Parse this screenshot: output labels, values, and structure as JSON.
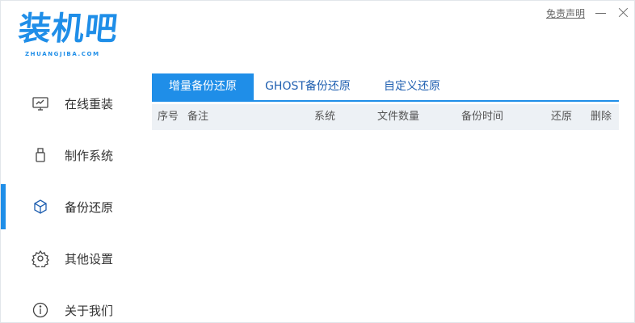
{
  "app": {
    "logo_text": "装机吧",
    "logo_subtext": "ZHUANGJIBA.COM",
    "disclaimer_label": "免责声明"
  },
  "sidebar": {
    "items": [
      {
        "label": "在线重装",
        "icon": "monitor-icon"
      },
      {
        "label": "制作系统",
        "icon": "usb-drive-icon"
      },
      {
        "label": "备份还原",
        "icon": "backup-restore-icon",
        "active": true
      },
      {
        "label": "其他设置",
        "icon": "gear-icon"
      },
      {
        "label": "关于我们",
        "icon": "info-icon"
      }
    ]
  },
  "tabs": [
    {
      "label": "增量备份还原",
      "active": true
    },
    {
      "label": "GHOST备份还原",
      "active": false
    },
    {
      "label": "自定义还原",
      "active": false
    }
  ],
  "table": {
    "columns": [
      "序号",
      "备注",
      "系统",
      "文件数量",
      "备份时间",
      "还原",
      "删除"
    ],
    "rows": []
  },
  "colors": {
    "accent": "#1f8ee8",
    "header_bg": "#edf1f5"
  }
}
